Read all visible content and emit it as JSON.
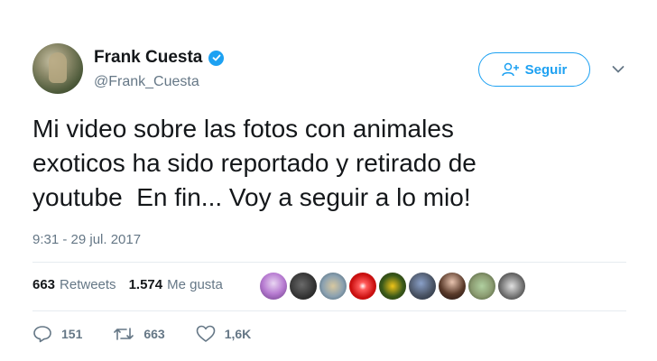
{
  "user": {
    "display_name": "Frank Cuesta",
    "handle": "@Frank_Cuesta",
    "verified": true
  },
  "follow_button": {
    "label": "Seguir",
    "icon": "add-user-icon"
  },
  "tweet": {
    "text": "Mi video sobre las fotos con animales\nexoticos ha sido reportado y retirado de\nyoutube  En fin... Voy a seguir a lo mio!",
    "timestamp": "9:31 - 29 jul. 2017"
  },
  "stats": {
    "retweets_count": "663",
    "retweets_label": "Retweets",
    "likes_count": "1.574",
    "likes_label": "Me gusta"
  },
  "actions": {
    "reply_count": "151",
    "retweet_count": "663",
    "like_count": "1,6K"
  },
  "colors": {
    "accent": "#1da1f2",
    "muted": "#657786",
    "text": "#14171a"
  }
}
